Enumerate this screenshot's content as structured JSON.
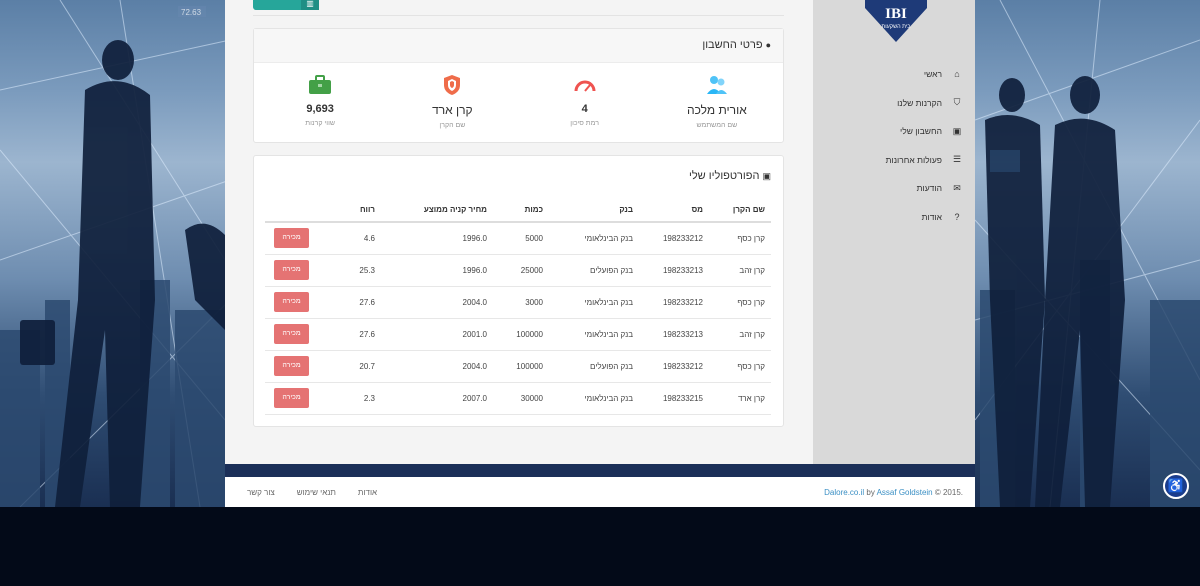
{
  "brand": {
    "logo_text": "IBI",
    "logo_sub": "בית השקעות"
  },
  "account_card": {
    "title": "פרטי החשבון",
    "stats": [
      {
        "value": "אורית מלכה",
        "label": "שם המשתמש",
        "icon": "users-icon",
        "color": "#29b6f6"
      },
      {
        "value": "4",
        "label": "רמת סיכון",
        "icon": "gauge-icon",
        "color": "#ef5350"
      },
      {
        "value": "קרן ארד",
        "label": "שם הקרן",
        "icon": "shield-icon",
        "color": "#ef5350"
      },
      {
        "value": "9,693",
        "label": "שווי קרנות",
        "icon": "briefcase-icon",
        "color": "#43a047"
      }
    ]
  },
  "portfolio": {
    "title": "הפורטפוליו שלי",
    "columns": [
      "שם הקרן",
      "מס",
      "בנק",
      "כמות",
      "מחיר קניה ממוצע",
      "רווח",
      ""
    ],
    "sell_label": "מכירה",
    "rows": [
      [
        "קרן כסף",
        "198233212",
        "בנק הבינלאומי",
        "5000",
        "1996.0",
        "4.6"
      ],
      [
        "קרן זהב",
        "198233213",
        "בנק הפועלים",
        "25000",
        "1996.0",
        "25.3"
      ],
      [
        "קרן כסף",
        "198233212",
        "בנק הבינלאומי",
        "3000",
        "2004.0",
        "27.6"
      ],
      [
        "קרן זהב",
        "198233213",
        "בנק הבינלאומי",
        "100000",
        "2001.0",
        "27.6"
      ],
      [
        "קרן כסף",
        "198233212",
        "בנק הפועלים",
        "100000",
        "2004.0",
        "20.7"
      ],
      [
        "קרן ארד",
        "198233215",
        "בנק הבינלאומי",
        "30000",
        "2007.0",
        "2.3"
      ]
    ]
  },
  "nav": [
    {
      "label": "ראשי",
      "icon": "home-icon",
      "glyph": "⌂"
    },
    {
      "label": "הקרנות שלנו",
      "icon": "shield-icon",
      "glyph": "⛉"
    },
    {
      "label": "החשבון שלי",
      "icon": "briefcase-icon",
      "glyph": "▣"
    },
    {
      "label": "פעולות אחרונות",
      "icon": "list-icon",
      "glyph": "☰"
    },
    {
      "label": "הודעות",
      "icon": "envelope-icon",
      "glyph": "✉"
    },
    {
      "label": "אודות",
      "icon": "question-circle-icon",
      "glyph": "?"
    }
  ],
  "footer": {
    "copyright": "© 2015. ",
    "author": "Assaf Goldstein",
    "by": " by ",
    "site": "Dalore.co.il",
    "links": [
      "אודות",
      "תנאי שימוש",
      "צור קשר"
    ]
  },
  "bg_label": "72.63"
}
